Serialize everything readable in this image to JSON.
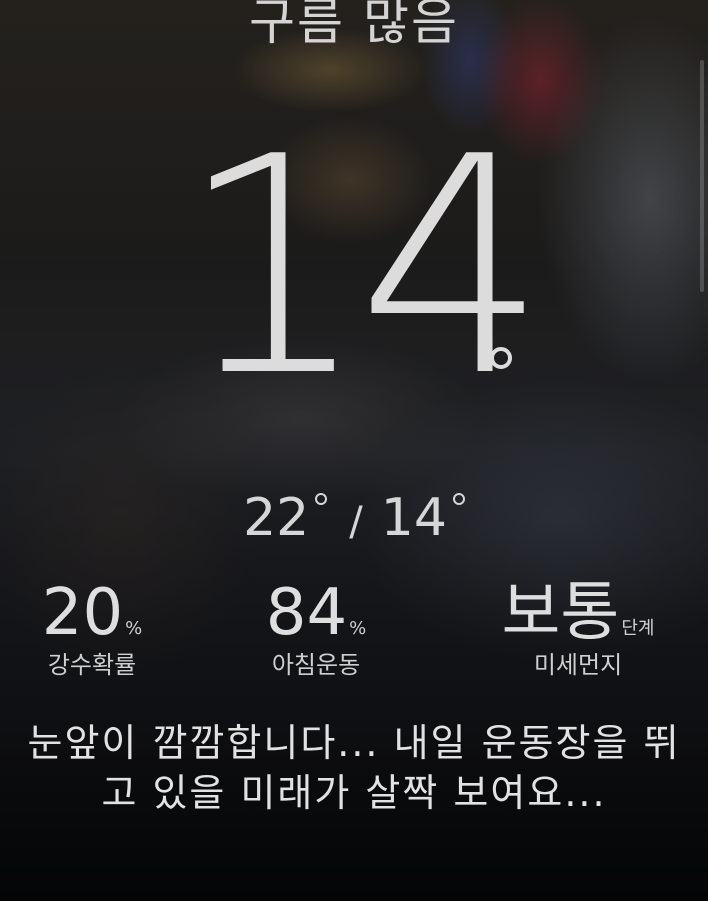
{
  "weather": {
    "condition": "구름 많음",
    "current_temp": "14",
    "high_temp": "22",
    "low_temp": "14",
    "separator": "/"
  },
  "stats": [
    {
      "value": "20",
      "unit": "%",
      "label": "강수확률"
    },
    {
      "value": "84",
      "unit": "%",
      "label": "아침운동"
    },
    {
      "value": "보통",
      "unit": "단계",
      "label": "미세먼지"
    }
  ],
  "message": {
    "line1": "눈앞이 깜깜합니다... 내일 운동장을 뛰",
    "line2": "고 있을 미래가 살짝 보여요..."
  },
  "colors": {
    "text": "#dcdcdc"
  }
}
